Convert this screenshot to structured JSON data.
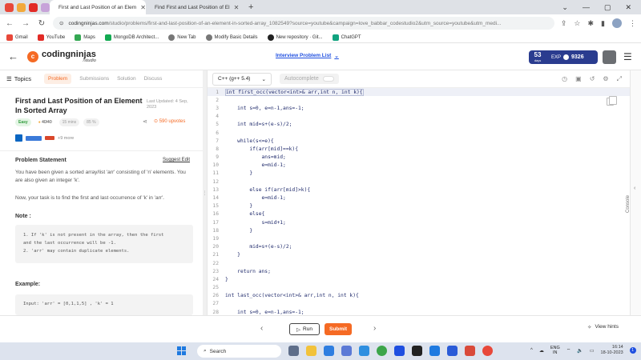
{
  "browser": {
    "tabs": [
      {
        "title": "First and Last Position of an Elem",
        "active": true
      },
      {
        "title": "Find First and Last Position of El",
        "active": false
      }
    ],
    "url_host": "codingninjas.com",
    "url_path": "/studio/problems/first-and-last-position-of-an-element-in-sorted-array_1082549?source=youtube&campaign=love_babbar_codestudio2&utm_source=youtube&utm_medi...",
    "bookmarks": [
      "Gmail",
      "YouTube",
      "Maps",
      "MongoDB Architect...",
      "New Tab",
      "Modify Basic Details",
      "New repository · Git...",
      "ChatGPT"
    ]
  },
  "header": {
    "logo_text": "codingninjas",
    "logo_sub": "/studio",
    "interview_list": "Interview Problem List",
    "streak_days": "53",
    "streak_unit": "days",
    "exp_label": "EXP",
    "exp_value": "9326"
  },
  "left_tabs": {
    "topics": "Topics",
    "items": [
      "Problem",
      "Submissions",
      "Solution",
      "Discuss"
    ]
  },
  "problem": {
    "title": "First and Last Position of an Element In Sorted Array",
    "updated": "Last Updated: 4 Sep, 2023",
    "difficulty": "Easy",
    "score": "40/40",
    "time": "15 mins",
    "accuracy": "85 %",
    "upvotes": "590 upvotes",
    "more_companies": "+9 more",
    "statement_head": "Problem Statement",
    "suggest_edit": "Suggest Edit",
    "statement_1": "You have been given a sorted array/list 'arr' consisting of 'n' elements. You are also given an integer 'k'.",
    "statement_2": "Now, your task is to find the first and last occurrence of 'k' in 'arr'.",
    "note_head": "Note :",
    "notes": [
      "1. If 'k' is not present in the array, then the first",
      "and the last occurrence will be -1.",
      "2. 'arr' may contain duplicate elements."
    ],
    "example_head": "Example:",
    "example_input": "Input: 'arr' = [0,1,1,5] , 'k' = 1"
  },
  "editor": {
    "language": "C++ (g++ 5.4)",
    "autocomplete": "Autocomplete",
    "lines": [
      "int first_occ(vector<int>& arr,int n, int k){",
      "",
      "    int s=0, e=n-1,ans=-1;",
      "",
      "    int mid=s+(e-s)/2;",
      "",
      "    while(s<=e){",
      "        if(arr[mid]==k){",
      "            ans=mid;",
      "            e=mid-1;",
      "        }",
      "",
      "        else if(arr[mid]>k){",
      "            e=mid-1;",
      "        }",
      "        else{",
      "            s=mid+1;",
      "        }",
      "",
      "        mid=s+(e-s)/2;",
      "    }",
      "",
      "    return ans;",
      "}",
      "",
      "int last_occ(vector<int>& arr,int n, int k){",
      "",
      "    int s=0, e=n-1,ans=-1;",
      ""
    ],
    "console_label": "Console"
  },
  "actions": {
    "run": "Run",
    "submit": "Submit",
    "view_hints": "View hints"
  },
  "taskbar": {
    "search": "Search",
    "lang_1": "ENG",
    "lang_2": "IN",
    "time": "16:14",
    "date": "18-10-2023"
  },
  "colors": {
    "accent": "#f56a24",
    "link": "#1f4fe0",
    "streak_bg": "#2a3c8f"
  }
}
